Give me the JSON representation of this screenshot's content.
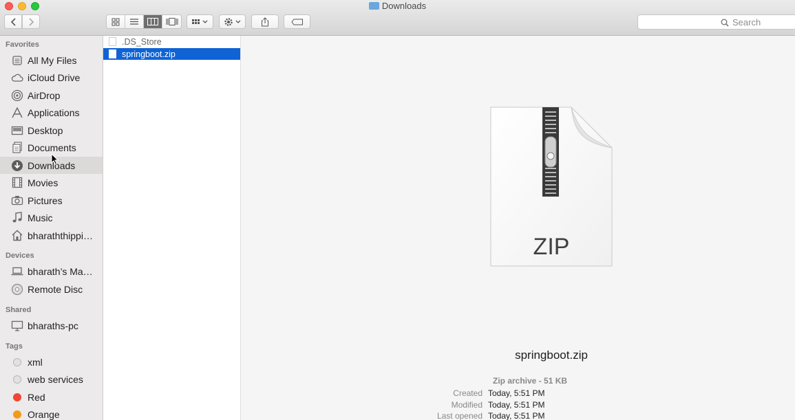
{
  "window": {
    "title": "Downloads"
  },
  "toolbar": {
    "back_icon": "chevron-left-icon",
    "forward_icon": "chevron-right-icon",
    "view_modes": [
      "icon-view",
      "list-view",
      "column-view",
      "cover-flow-view"
    ],
    "active_view": "column-view",
    "search_placeholder": "Search"
  },
  "sidebar": {
    "favorites_label": "Favorites",
    "favorites": [
      {
        "label": "All My Files",
        "icon": "all-files-icon"
      },
      {
        "label": "iCloud Drive",
        "icon": "cloud-icon"
      },
      {
        "label": "AirDrop",
        "icon": "airdrop-icon"
      },
      {
        "label": "Applications",
        "icon": "applications-icon"
      },
      {
        "label": "Desktop",
        "icon": "desktop-icon"
      },
      {
        "label": "Documents",
        "icon": "documents-icon"
      },
      {
        "label": "Downloads",
        "icon": "downloads-icon",
        "selected": true
      },
      {
        "label": "Movies",
        "icon": "movies-icon"
      },
      {
        "label": "Pictures",
        "icon": "camera-icon"
      },
      {
        "label": "Music",
        "icon": "music-icon"
      },
      {
        "label": "bharaththippi…",
        "icon": "home-icon"
      }
    ],
    "devices_label": "Devices",
    "devices": [
      {
        "label": "bharath’s Ma…",
        "icon": "laptop-icon"
      },
      {
        "label": "Remote Disc",
        "icon": "disc-icon"
      }
    ],
    "shared_label": "Shared",
    "shared": [
      {
        "label": "bharaths-pc",
        "icon": "pc-icon"
      }
    ],
    "tags_label": "Tags",
    "tags": [
      {
        "label": "xml",
        "color": "#d0d0d0"
      },
      {
        "label": "web services",
        "color": "#d0d0d0"
      },
      {
        "label": "Red",
        "color": "#f04535"
      },
      {
        "label": "Orange",
        "color": "#f39a1c"
      }
    ]
  },
  "files": [
    {
      "name": ".DS_Store",
      "selected": false
    },
    {
      "name": "springboot.zip",
      "selected": true
    }
  ],
  "preview": {
    "icon_label": "ZIP",
    "file_name": "springboot.zip",
    "kind": "Zip archive - 51 KB",
    "meta": [
      {
        "key": "Created",
        "value": "Today, 5:51 PM"
      },
      {
        "key": "Modified",
        "value": "Today, 5:51 PM"
      },
      {
        "key": "Last opened",
        "value": "Today, 5:51 PM"
      }
    ]
  },
  "colors": {
    "selection": "#0f63d4",
    "red_tag": "#f04535",
    "orange_tag": "#f39a1c"
  }
}
